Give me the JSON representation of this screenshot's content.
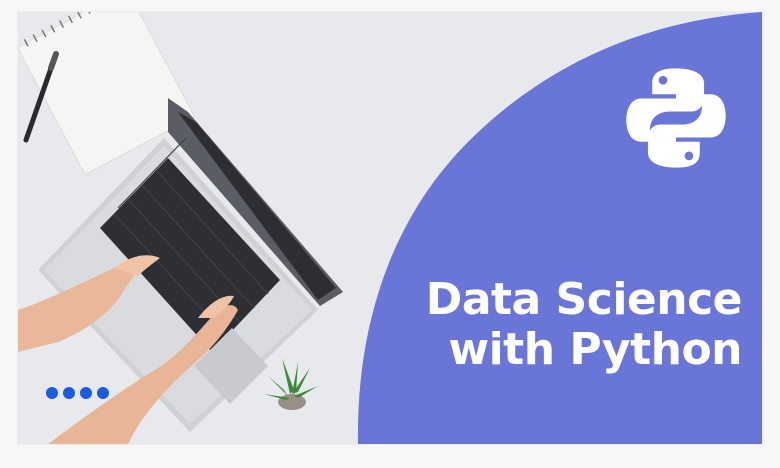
{
  "banner": {
    "title_line1": "Data Science",
    "title_line2": "with Python",
    "logo_icon": "python-logo-icon",
    "accent_color": "#6a75d8",
    "background_color": "#e8e9ed"
  },
  "carousel": {
    "dot_count": 4,
    "dot_color": "#1a5be0"
  }
}
